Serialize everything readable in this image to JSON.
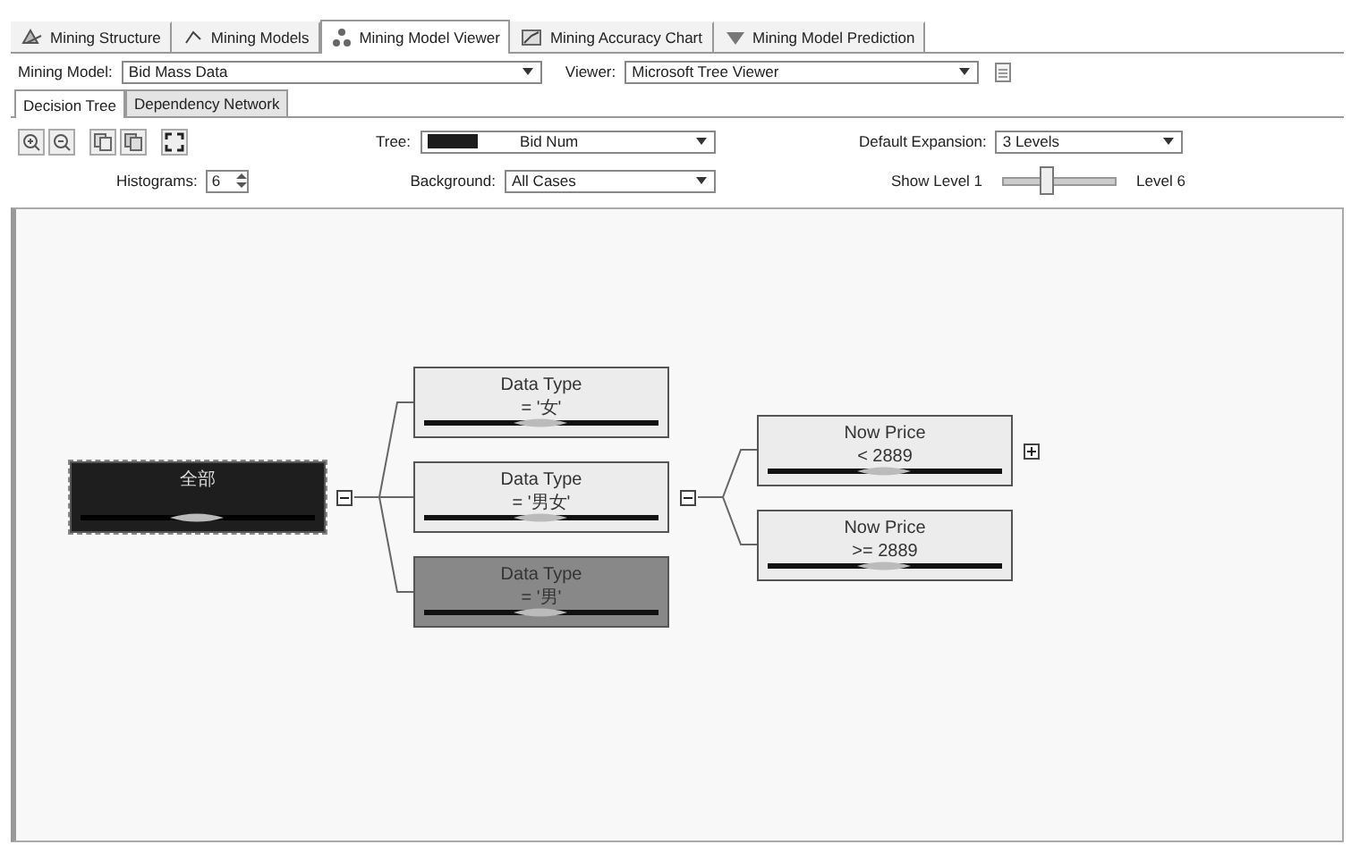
{
  "designer_tabs": [
    {
      "label": "Mining Structure",
      "selected": false
    },
    {
      "label": "Mining Models",
      "selected": false
    },
    {
      "label": "Mining Model Viewer",
      "selected": true
    },
    {
      "label": "Mining Accuracy Chart",
      "selected": false
    },
    {
      "label": "Mining Model Prediction",
      "selected": false
    }
  ],
  "model_bar": {
    "model_label": "Mining Model:",
    "model_value": "Bid Mass Data",
    "viewer_label": "Viewer:",
    "viewer_value": "Microsoft Tree Viewer"
  },
  "viewer_tabs": [
    {
      "label": "Decision Tree",
      "selected": true
    },
    {
      "label": "Dependency Network",
      "selected": false
    }
  ],
  "toolbar": {
    "tree_label": "Tree:",
    "tree_value": "Bid Num",
    "expansion_label": "Default Expansion:",
    "expansion_value": "3 Levels",
    "histograms_label": "Histograms:",
    "histograms_value": "6",
    "background_label": "Background:",
    "background_value": "All Cases",
    "show_level_label": "Show Level 1",
    "level_end_label": "Level 6",
    "level": 0.4
  },
  "tree": {
    "title": "全部",
    "color": "#1e1e1e",
    "expanded": true,
    "children": [
      {
        "title": "Data Type",
        "condition": "= '女'",
        "color": "#ececec"
      },
      {
        "title": "Data Type",
        "condition": "= '男女'",
        "color": "#ececec",
        "expanded": true,
        "children": [
          {
            "title": "Now Price",
            "condition": "< 2889",
            "color": "#ececec",
            "expanded": false
          },
          {
            "title": "Now Price",
            "condition": ">= 2889",
            "color": "#ececec"
          }
        ]
      },
      {
        "title": "Data Type",
        "condition": "= '男'",
        "color": "#888888"
      }
    ]
  }
}
